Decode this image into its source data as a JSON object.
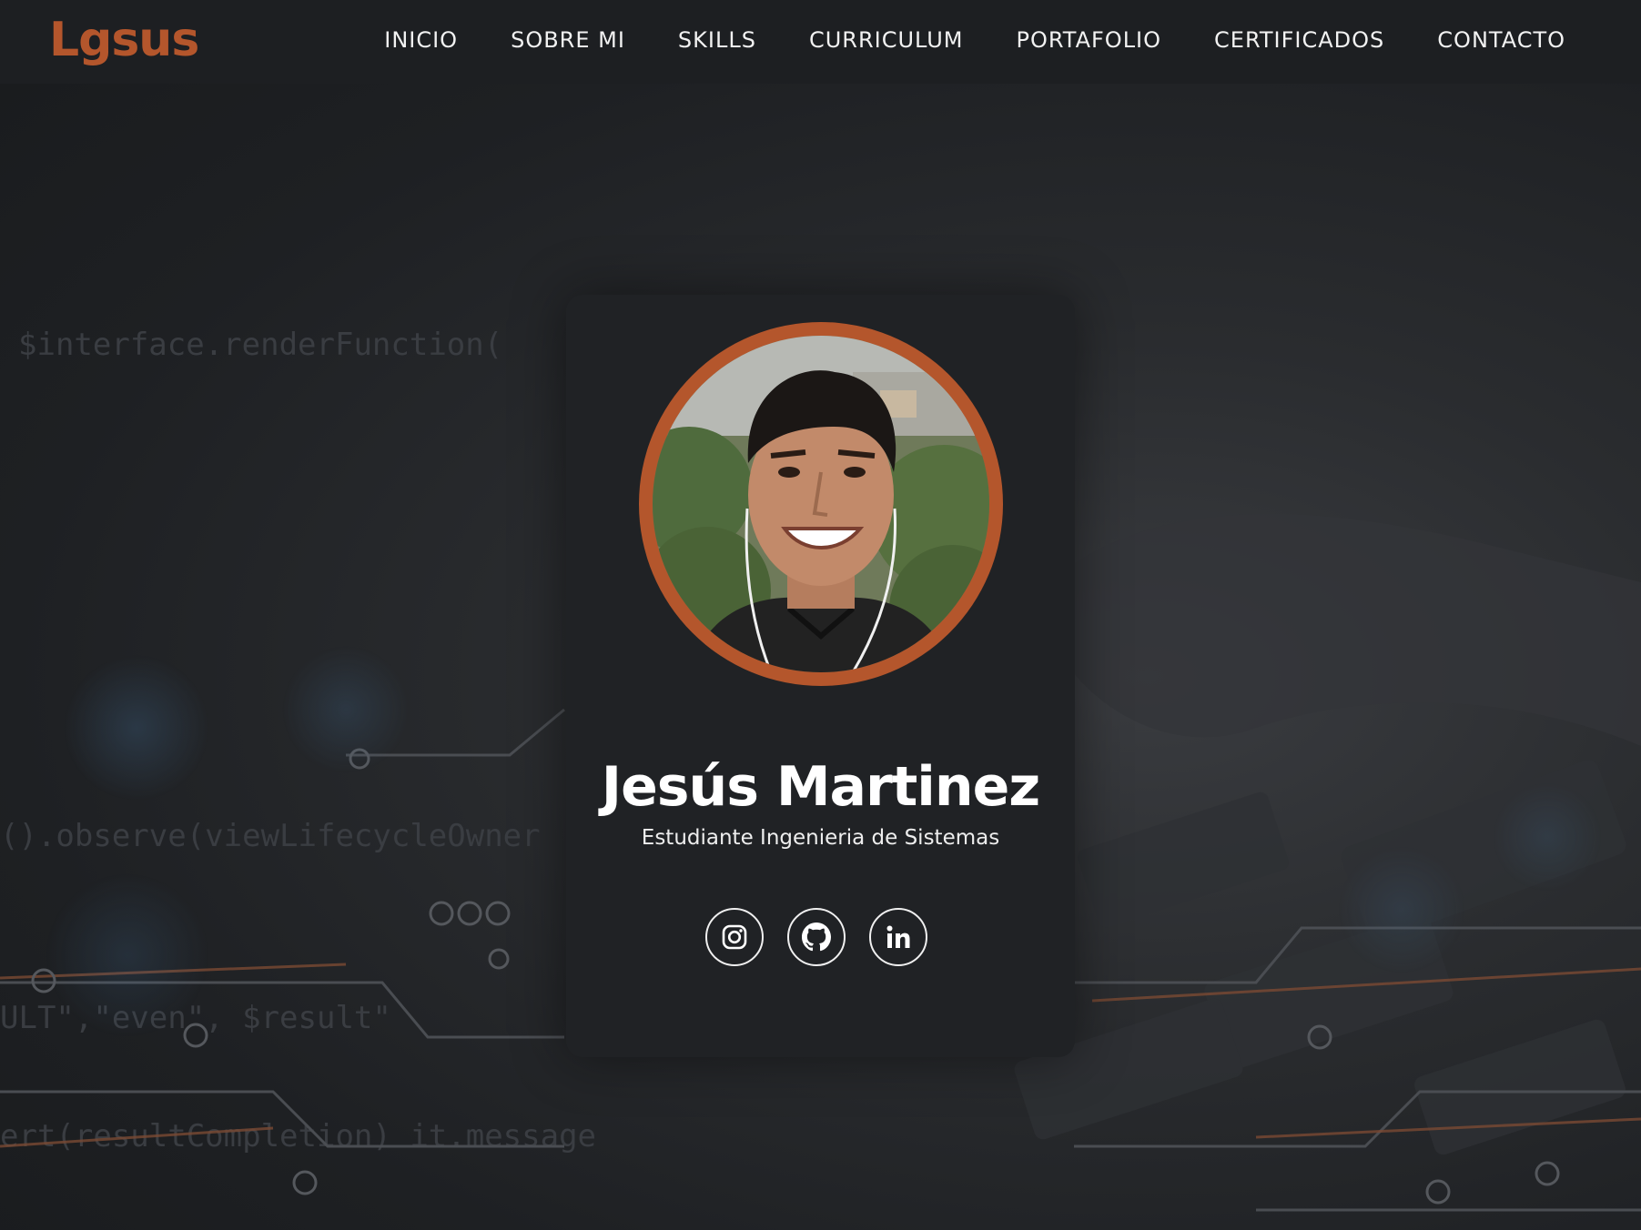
{
  "navbar": {
    "logo": "Lgsus",
    "links": [
      {
        "label": "INICIO"
      },
      {
        "label": "SOBRE MI"
      },
      {
        "label": "SKILLS"
      },
      {
        "label": "CURRICULUM"
      },
      {
        "label": "PORTAFOLIO"
      },
      {
        "label": "CERTIFICADOS"
      },
      {
        "label": "CONTACTO"
      }
    ]
  },
  "profile": {
    "name": "Jesús Martinez",
    "role": "Estudiante Ingenieria de Sistemas",
    "avatar_icon": "profile-photo",
    "socials": [
      {
        "icon": "instagram-icon"
      },
      {
        "icon": "github-icon"
      },
      {
        "icon": "linkedin-icon"
      }
    ]
  },
  "colors": {
    "accent": "#b4562c",
    "background": "#1b1d20",
    "card": "#202225",
    "text": "#ffffff"
  }
}
